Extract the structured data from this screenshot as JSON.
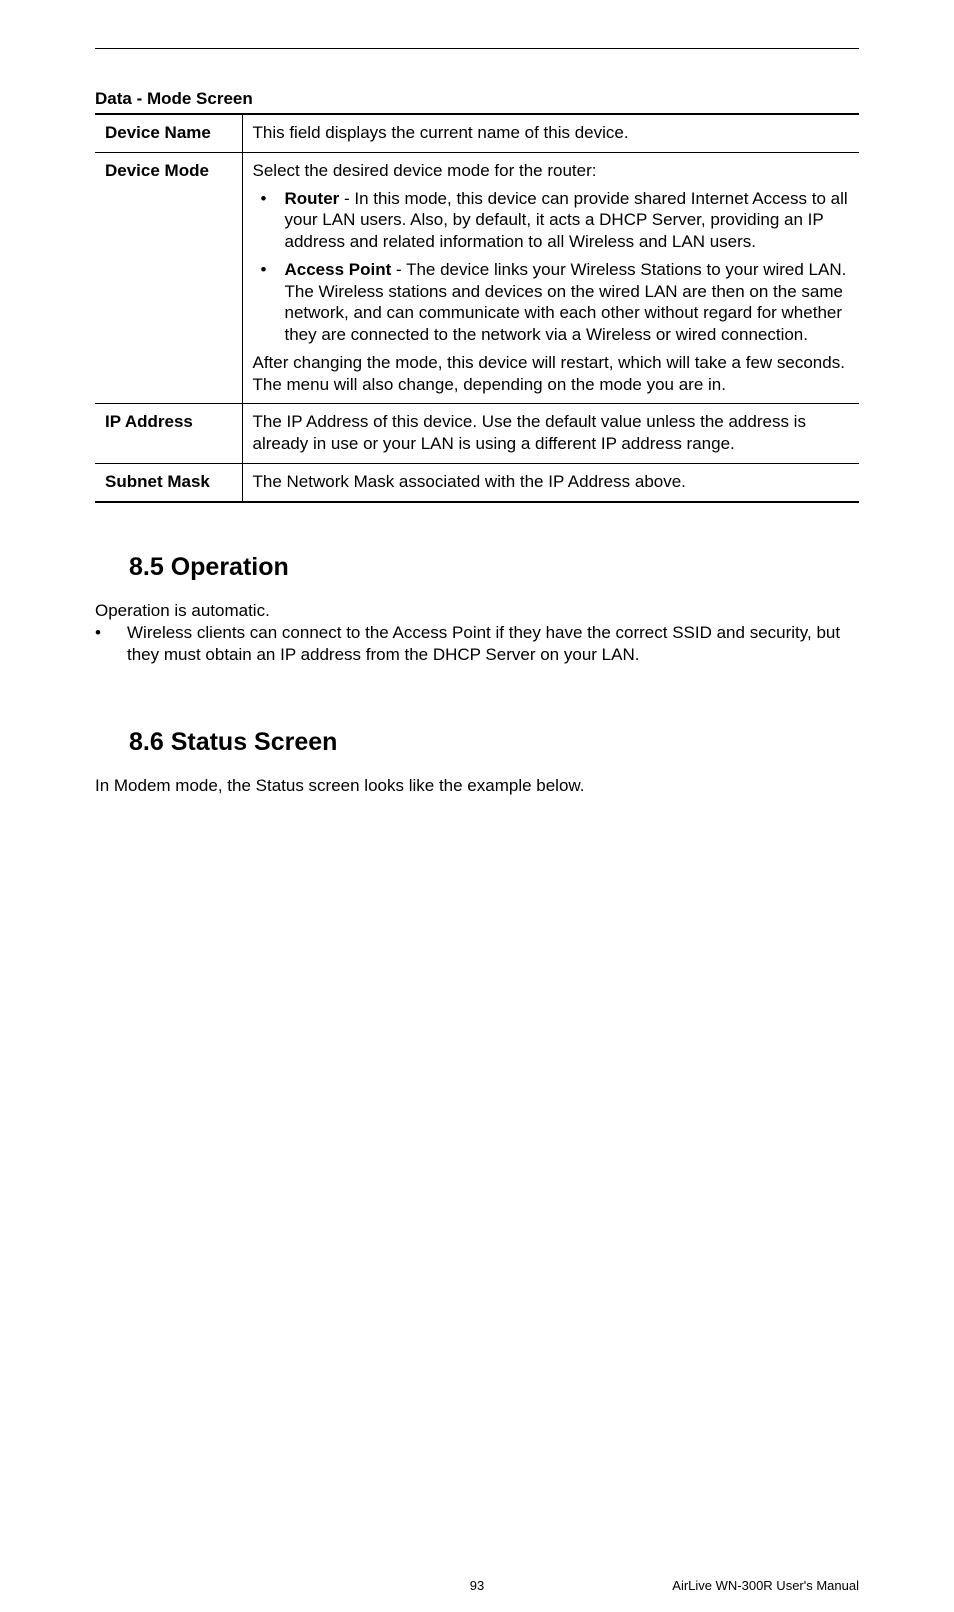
{
  "table_title": "Data - Mode Screen",
  "rows": {
    "device_name": {
      "label": "Device Name",
      "content": "This field displays the current name of this device."
    },
    "device_mode": {
      "label": "Device Mode",
      "intro": "Select the desired device mode for the router:",
      "bullet1_bold": "Router",
      "bullet1_rest": " - In this mode, this device can provide shared Internet Access to all your LAN users. Also, by default, it acts a DHCP Server, providing an IP address and related information to all Wireless and LAN users.",
      "bullet2_bold": "Access Point",
      "bullet2_rest": " - The device links your Wireless Stations to your wired LAN. The Wireless stations and devices on the wired LAN are then on the same network, and can communicate with each other without regard for whether they are connected to the network via a Wireless or wired connection.",
      "after": "After changing the mode, this device will restart, which will take a few seconds. The menu will also change, depending on the mode you are in."
    },
    "ip_address": {
      "label": "IP Address",
      "content": "The IP Address of this device. Use the default value unless the address is already in use or your LAN is using a different IP address range."
    },
    "subnet_mask": {
      "label": "Subnet Mask",
      "content": "The Network Mask associated with the IP Address above."
    }
  },
  "section_85": {
    "heading": "8.5  Operation",
    "para": "Operation is automatic.",
    "bullet": "Wireless clients can connect to the Access Point if they have the correct SSID and security, but they must obtain an IP address from the DHCP Server on your LAN."
  },
  "section_86": {
    "heading": "8.6  Status Screen",
    "para": "In Modem mode, the Status screen looks like the example below."
  },
  "footer": {
    "page": "93",
    "right": "AirLive WN-300R User's Manual"
  }
}
